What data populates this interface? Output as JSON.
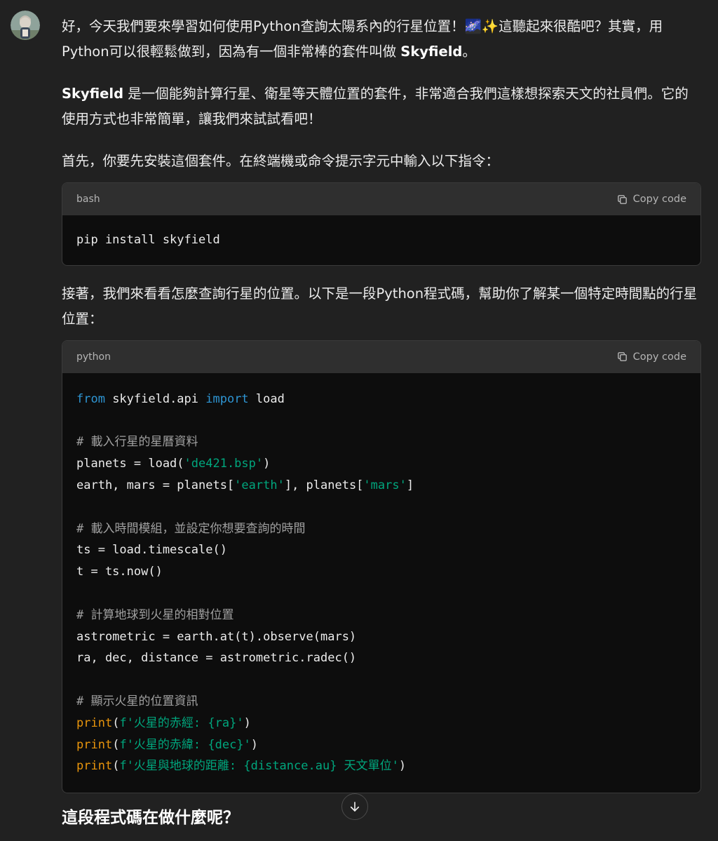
{
  "message": {
    "p1": "好，今天我們要來學習如何使用Python查詢太陽系內的行星位置！🌌✨這聽起來很酷吧？其實，用Python可以很輕鬆做到，因為有一個非常棒的套件叫做 ",
    "p1_strong": "Skyfield",
    "p1_end": "。",
    "p2_strong": "Skyfield",
    "p2": " 是一個能夠計算行星、衛星等天體位置的套件，非常適合我們這樣想探索天文的社員們。它的使用方式也非常簡單，讓我們來試試看吧！",
    "p3": "首先，你要先安裝這個套件。在終端機或命令提示字元中輸入以下指令：",
    "p4": "接著，我們來看看怎麼查詢行星的位置。以下是一段Python程式碼，幫助你了解某一個特定時間點的行星位置：",
    "heading": "這段程式碼在做什麼呢？"
  },
  "code_blocks": [
    {
      "language": "bash",
      "copy_label": "Copy code",
      "lines": [
        "pip install skyfield"
      ]
    },
    {
      "language": "python",
      "copy_label": "Copy code",
      "lines": [
        "from skyfield.api import load",
        "",
        "# 載入行星的星曆資料",
        "planets = load('de421.bsp')",
        "earth, mars = planets['earth'], planets['mars']",
        "",
        "# 載入時間模組，並設定你想要查詢的時間",
        "ts = load.timescale()",
        "t = ts.now()",
        "",
        "# 計算地球到火星的相對位置",
        "astrometric = earth.at(t).observe(mars)",
        "ra, dec, distance = astrometric.radec()",
        "",
        "# 顯示火星的位置資訊",
        "print(f'火星的赤經: {ra}')",
        "print(f'火星的赤緯: {dec}')",
        "print(f'火星與地球的距離: {distance.au} 天文單位')"
      ]
    }
  ],
  "icons": {
    "avatar": "avatar-image",
    "copy": "copy-icon",
    "scroll": "arrow-down-icon"
  },
  "colors": {
    "background": "#212121",
    "code_header": "#2f2f2f",
    "code_body": "#0d0d0d",
    "keyword": "#2e95d3",
    "string": "#00a67d",
    "comment": "#a0a0a0",
    "builtin": "#e9950c"
  }
}
